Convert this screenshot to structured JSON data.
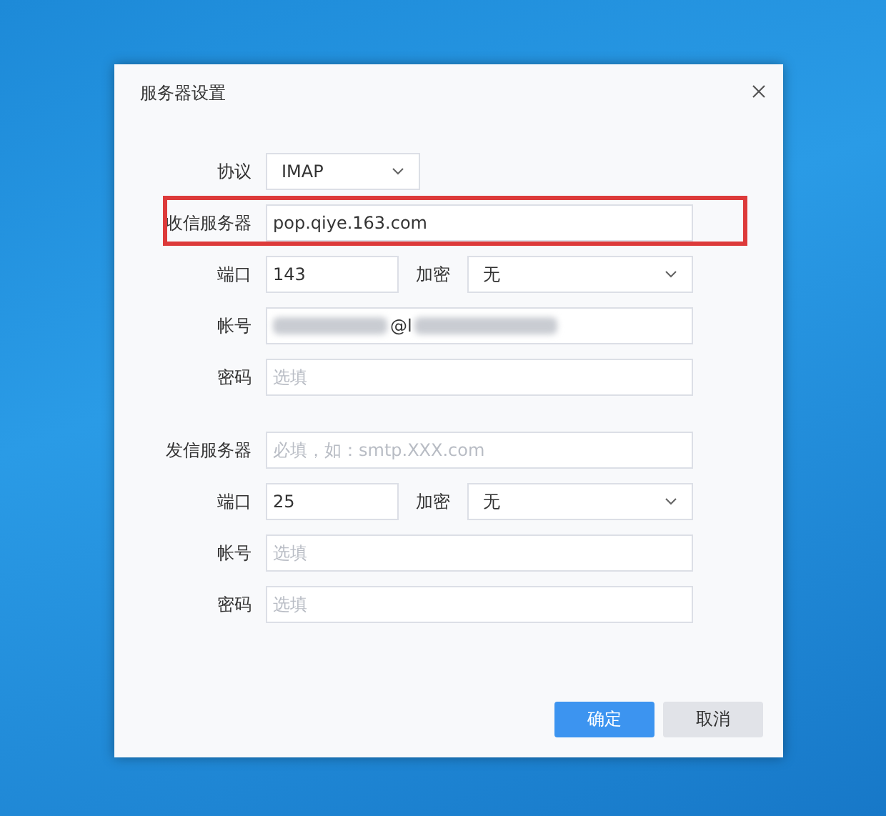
{
  "window": {
    "title": "服务器设置"
  },
  "sections": [
    {
      "rows": [
        {
          "kind": "select",
          "label": "协议",
          "value": "IMAP",
          "highlighted": false
        },
        {
          "kind": "text",
          "label": "收信服务器",
          "value": "pop.qiye.163.com",
          "highlighted": true,
          "redacted": false
        },
        {
          "kind": "port",
          "label": "端口",
          "value": "143",
          "encryption_label": "加密",
          "encryption": "无",
          "highlighted": false
        },
        {
          "kind": "text",
          "label": "帐号",
          "value": "@l",
          "highlighted": false,
          "redacted": true
        },
        {
          "kind": "text",
          "label": "密码",
          "placeholder": "选填",
          "highlighted": false,
          "redacted": false
        }
      ]
    },
    {
      "rows": [
        {
          "kind": "text",
          "label": "发信服务器",
          "placeholder": "必填，如：smtp.XXX.com",
          "highlighted": false,
          "redacted": false
        },
        {
          "kind": "port",
          "label": "端口",
          "value": "25",
          "encryption_label": "加密",
          "encryption": "无",
          "highlighted": false
        },
        {
          "kind": "text",
          "label": "帐号",
          "placeholder": "选填",
          "highlighted": false,
          "redacted": false
        },
        {
          "kind": "text",
          "label": "密码",
          "placeholder": "选填",
          "highlighted": false,
          "redacted": false
        }
      ]
    }
  ],
  "buttons": [
    {
      "label": "确定",
      "kind": "primary"
    },
    {
      "label": "取消",
      "kind": "secondary"
    }
  ]
}
